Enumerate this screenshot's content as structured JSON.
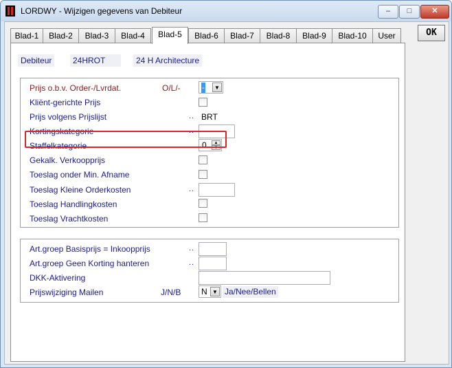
{
  "window": {
    "title": "LORDWY - Wijzigen gegevens van Debiteur",
    "min": "–",
    "max": "□",
    "close": "✕"
  },
  "ok_label": "OK",
  "tabs": [
    "Blad-1",
    "Blad-2",
    "Blad-3",
    "Blad-4",
    "Blad-5",
    "Blad-6",
    "Blad-7",
    "Blad-8",
    "Blad-9",
    "Blad-10",
    "User"
  ],
  "header": {
    "label": "Debiteur",
    "code": "24HROT",
    "name": "24 H Architecture"
  },
  "group1": {
    "rows": [
      {
        "label": "Prijs o.b.v. Order-/Lvrdat.",
        "code": "O/L/-"
      },
      {
        "label": "Kliënt-gerichte Prijs"
      },
      {
        "label": "Prijs volgens Prijslijst",
        "dots": "..",
        "value": "BRT"
      },
      {
        "label": "Kortingskategorie",
        "dots": ".."
      },
      {
        "label": "Staffelkategorie",
        "value": "0"
      },
      {
        "label": "Gekalk. Verkoopprijs"
      },
      {
        "label": "Toeslag onder Min. Afname"
      },
      {
        "label": "Toeslag Kleine Orderkosten",
        "dots": ".."
      },
      {
        "label": "Toeslag Handlingkosten"
      },
      {
        "label": "Toeslag Vrachtkosten"
      }
    ],
    "order_combo_value": "-"
  },
  "group2": {
    "rows": [
      {
        "label": "Art.groep Basisprijs = Inkoopprijs",
        "dots": ".."
      },
      {
        "label": "Art.groep Geen Korting hanteren",
        "dots": ".."
      },
      {
        "label": "DKK-Aktivering"
      },
      {
        "label": "Prijswijziging Mailen",
        "code": "J/N/B",
        "value": "N",
        "desc": "Ja/Nee/Bellen"
      }
    ]
  },
  "icons": {
    "dropdown": "▼",
    "spin_up": "▲",
    "spin_down": "▼"
  }
}
